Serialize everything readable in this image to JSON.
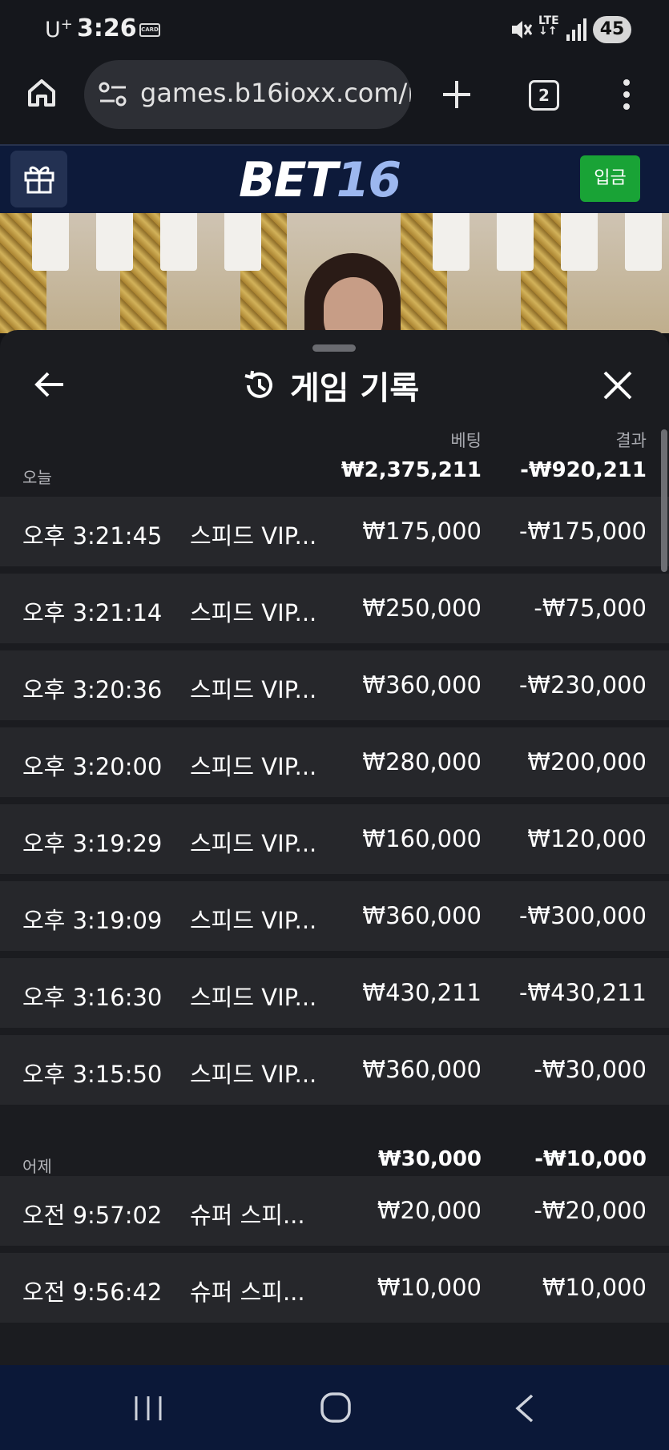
{
  "status_bar": {
    "carrier": "U",
    "carrier_sup": "+",
    "time": "3:26",
    "card_label": "CARD",
    "network": "LTE",
    "battery": "45"
  },
  "browser": {
    "url": "games.b16ioxx.com/i",
    "tab_count": "2"
  },
  "site": {
    "logo_bet": "BET",
    "logo_num": "16",
    "deposit_label": "입금",
    "accent_green": "#19a336",
    "header_bg": "#0d1a3a"
  },
  "panel": {
    "title": "게임 기록",
    "col_bet": "베팅",
    "col_result": "결과",
    "groups": [
      {
        "label": "오늘",
        "total_bet": "₩2,375,211",
        "total_result": "-₩920,211",
        "rows": [
          {
            "time": "오후 3:21:45",
            "game": "스피드 VIP...",
            "bet": "₩175,000",
            "result": "-₩175,000"
          },
          {
            "time": "오후 3:21:14",
            "game": "스피드 VIP...",
            "bet": "₩250,000",
            "result": "-₩75,000"
          },
          {
            "time": "오후 3:20:36",
            "game": "스피드 VIP...",
            "bet": "₩360,000",
            "result": "-₩230,000"
          },
          {
            "time": "오후 3:20:00",
            "game": "스피드 VIP...",
            "bet": "₩280,000",
            "result": "₩200,000"
          },
          {
            "time": "오후 3:19:29",
            "game": "스피드 VIP...",
            "bet": "₩160,000",
            "result": "₩120,000"
          },
          {
            "time": "오후 3:19:09",
            "game": "스피드 VIP...",
            "bet": "₩360,000",
            "result": "-₩300,000"
          },
          {
            "time": "오후 3:16:30",
            "game": "스피드 VIP...",
            "bet": "₩430,211",
            "result": "-₩430,211"
          },
          {
            "time": "오후 3:15:50",
            "game": "스피드 VIP...",
            "bet": "₩360,000",
            "result": "-₩30,000"
          }
        ]
      },
      {
        "label": "어제",
        "total_bet": "₩30,000",
        "total_result": "-₩10,000",
        "rows": [
          {
            "time": "오전 9:57:02",
            "game": "슈퍼 스피...",
            "bet": "₩20,000",
            "result": "-₩20,000"
          },
          {
            "time": "오전 9:56:42",
            "game": "슈퍼 스피...",
            "bet": "₩10,000",
            "result": "₩10,000"
          }
        ]
      }
    ]
  }
}
